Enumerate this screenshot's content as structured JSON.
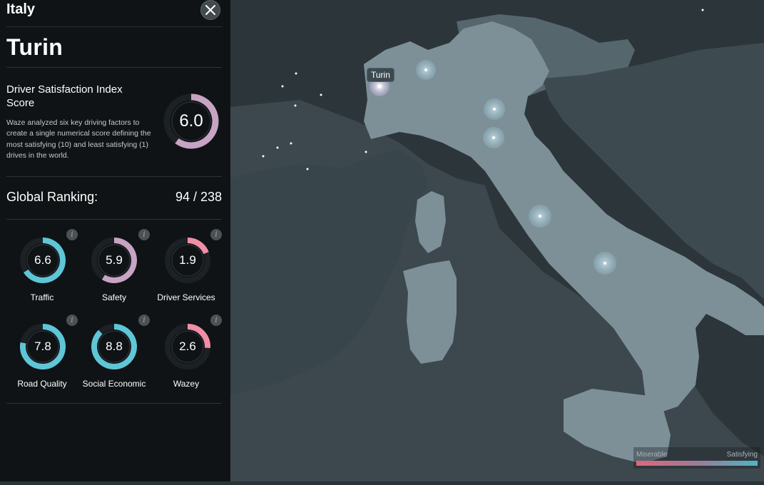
{
  "panel": {
    "country": "Italy",
    "city": "Turin",
    "dsi": {
      "title": "Driver Satisfaction Index Score",
      "description": "Waze analyzed six key driving factors to create a single numerical score defining the most satisfying (10) and least satisfying (1) drives in the world.",
      "score": 6.0,
      "score_label": "6.0"
    },
    "ranking": {
      "label": "Global Ranking:",
      "value": "94 / 238"
    },
    "metrics": [
      {
        "name": "Traffic",
        "score": 6.6,
        "label": "6.6",
        "color": "#5ec6d6"
      },
      {
        "name": "Safety",
        "score": 5.9,
        "label": "5.9",
        "color": "#c7a3c4"
      },
      {
        "name": "Driver Services",
        "score": 1.9,
        "label": "1.9",
        "color": "#f08ea5"
      },
      {
        "name": "Road Quality",
        "score": 7.8,
        "label": "7.8",
        "color": "#5ec6d6"
      },
      {
        "name": "Social Economic",
        "score": 8.8,
        "label": "8.8",
        "color": "#5ec6d6"
      },
      {
        "name": "Wazey",
        "score": 2.6,
        "label": "2.6",
        "color": "#f08ea5"
      }
    ],
    "info_icon": "i",
    "dsi_color": "#c7a3c4"
  },
  "map": {
    "selected_city": "Turin"
  },
  "legend": {
    "low_label": "Miserable",
    "high_label": "Satisfying"
  },
  "icons": {
    "close": "close-icon",
    "info": "info-icon"
  }
}
